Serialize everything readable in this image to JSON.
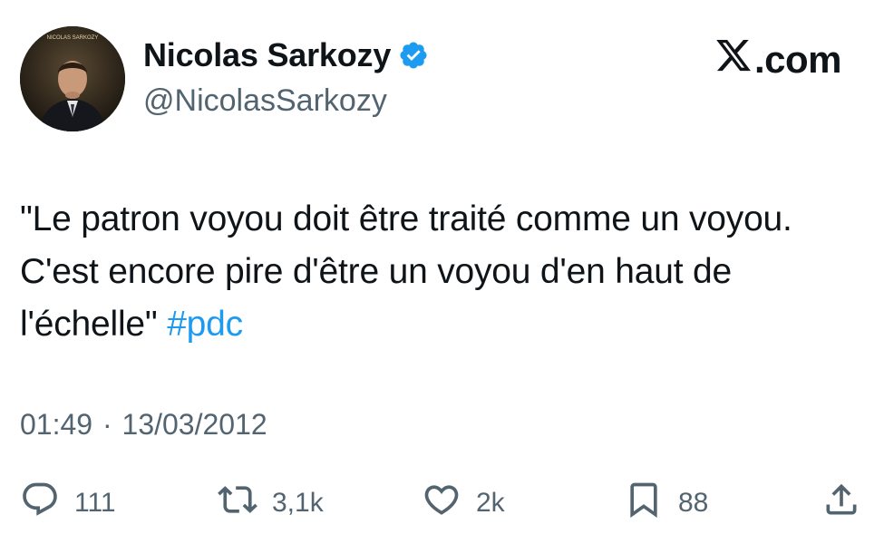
{
  "author": {
    "display_name": "Nicolas Sarkozy",
    "handle": "@NicolasSarkozy",
    "verified": true,
    "avatar_text": "NICOLAS SARKOZY"
  },
  "brand": {
    "label": ".com",
    "icon": "x-logo-icon"
  },
  "tweet": {
    "text": "\"Le patron voyou doit être traité comme un voyou. C'est encore pire d'être un voyou d'en haut de l'échelle\" ",
    "hashtag": "#pdc",
    "time": "01:49",
    "separator": "·",
    "date": "13/03/2012"
  },
  "actions": {
    "reply": {
      "icon": "reply-icon",
      "count": "111"
    },
    "retweet": {
      "icon": "retweet-icon",
      "count": "3,1k"
    },
    "like": {
      "icon": "heart-icon",
      "count": "2k"
    },
    "bookmark": {
      "icon": "bookmark-icon",
      "count": "88"
    },
    "share": {
      "icon": "share-icon"
    }
  },
  "colors": {
    "text": "#0f1419",
    "secondary": "#536471",
    "accent": "#1d9bf0"
  }
}
